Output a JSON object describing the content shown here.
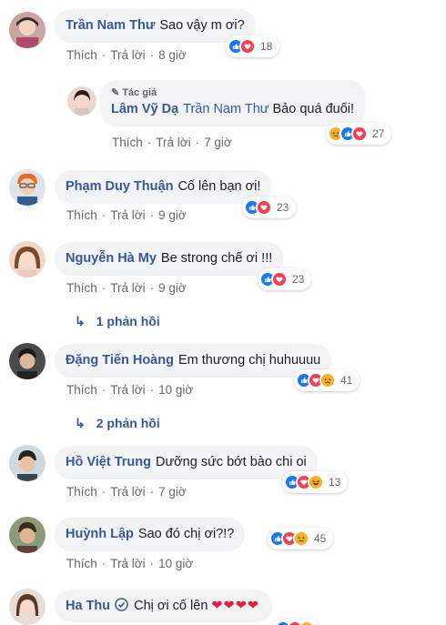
{
  "actions": {
    "like": "Thích",
    "reply": "Trả lời"
  },
  "author_tag": "Tác giả",
  "comments": [
    {
      "name": "Trần Nam Thư",
      "text": "Sao vậy m ơi?",
      "time": "8 giờ",
      "reactions": [
        "like",
        "love"
      ],
      "count": "18"
    },
    {
      "name": "Lâm Vỹ Dạ",
      "mention": "Trần Nam Thư",
      "text": "Bảo quá đuối!",
      "time": "7 giờ",
      "reactions": [
        "sad",
        "like",
        "love"
      ],
      "count": "27"
    },
    {
      "name": "Phạm Duy Thuận",
      "text": "Cố lên bạn ơi!",
      "time": "9 giờ",
      "reactions": [
        "like",
        "love"
      ],
      "count": "23"
    },
    {
      "name": "Nguyễn Hà My",
      "text": "Be strong chế ơi !!!",
      "time": "9 giờ",
      "reactions": [
        "like",
        "love"
      ],
      "count": "23",
      "replies": "1 phản hồi"
    },
    {
      "name": "Đặng Tiến Hoàng",
      "text": "Em thương chị huhuuuu",
      "time": "10 giờ",
      "reactions": [
        "like",
        "love",
        "sad"
      ],
      "count": "41",
      "replies": "2 phản hồi"
    },
    {
      "name": "Hồ Việt Trung",
      "text": "Dưỡng sức bớt bào chi oi",
      "time": "7 giờ",
      "reactions": [
        "like",
        "love",
        "haha"
      ],
      "count": "13"
    },
    {
      "name": "Huỳnh Lập",
      "text": "Sao đó chị ơi?!?",
      "time": "10 giờ",
      "reactions": [
        "like",
        "love",
        "sad"
      ],
      "count": "45"
    },
    {
      "name": "Ha Thu",
      "text": "Chị ơi cố lên",
      "hearts": "❤❤❤❤"
    }
  ],
  "colors": {
    "name": "#385898",
    "bubble": "#f2f3f5",
    "like": "#1877f2",
    "love": "#f33e58",
    "sad": "#f7b125"
  }
}
